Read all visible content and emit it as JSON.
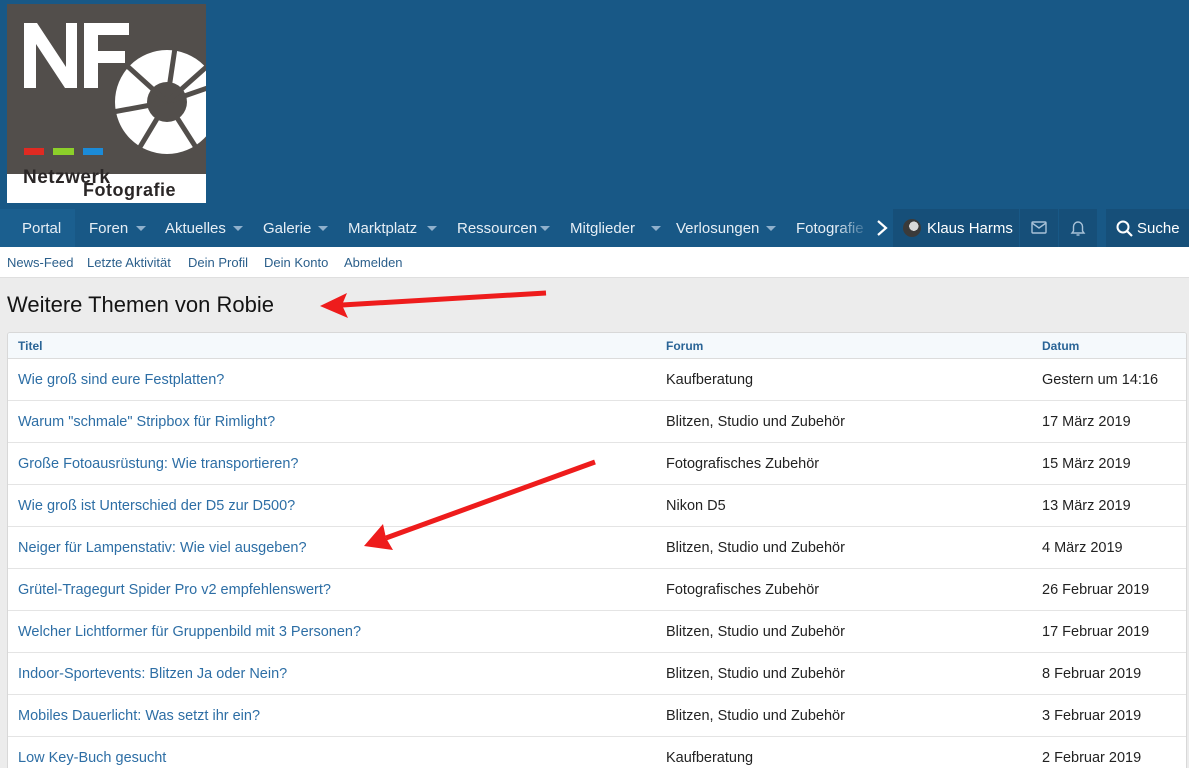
{
  "logo": {
    "letters": "NF",
    "word1": "Netzwerk",
    "word2": "Fotografie",
    "colors": [
      "#e02a22",
      "#8ccf2a",
      "#1b8bd8"
    ]
  },
  "nav": {
    "items": [
      {
        "label": "Portal",
        "dropdown": false
      },
      {
        "label": "Foren",
        "dropdown": true
      },
      {
        "label": "Aktuelles",
        "dropdown": true
      },
      {
        "label": "Galerie",
        "dropdown": true
      },
      {
        "label": "Marktplatz",
        "dropdown": true
      },
      {
        "label": "Ressourcen",
        "dropdown": true
      },
      {
        "label": "Mitglieder",
        "dropdown": true
      },
      {
        "label": "Verlosungen",
        "dropdown": true
      },
      {
        "label": "Fotografie",
        "dropdown": false
      }
    ],
    "user_name": "Klaus Harms",
    "search_label": "Suche"
  },
  "subnav": {
    "items": [
      "News-Feed",
      "Letzte Aktivität",
      "Dein Profil",
      "Dein Konto",
      "Abmelden"
    ]
  },
  "page": {
    "title": "Weitere Themen von Robie"
  },
  "table": {
    "headers": {
      "title": "Titel",
      "forum": "Forum",
      "date": "Datum"
    },
    "rows": [
      {
        "title": "Wie groß sind eure Festplatten?",
        "forum": "Kaufberatung",
        "date": "Gestern um 14:16"
      },
      {
        "title": "Warum \"schmale\" Stripbox für Rimlight?",
        "forum": "Blitzen, Studio und Zubehör",
        "date": "17 März 2019"
      },
      {
        "title": "Große Fotoausrüstung: Wie transportieren?",
        "forum": "Fotografisches Zubehör",
        "date": "15 März 2019"
      },
      {
        "title": "Wie groß ist Unterschied der D5 zur D500?",
        "forum": "Nikon D5",
        "date": "13 März 2019"
      },
      {
        "title": "Neiger für Lampenstativ: Wie viel ausgeben?",
        "forum": "Blitzen, Studio und Zubehör",
        "date": "4 März 2019"
      },
      {
        "title": "Grütel-Tragegurt Spider Pro v2 empfehlenswert?",
        "forum": "Fotografisches Zubehör",
        "date": "26 Februar 2019"
      },
      {
        "title": "Welcher Lichtformer für Gruppenbild mit 3 Personen?",
        "forum": "Blitzen, Studio und Zubehör",
        "date": "17 Februar 2019"
      },
      {
        "title": "Indoor-Sportevents: Blitzen Ja oder Nein?",
        "forum": "Blitzen, Studio und Zubehör",
        "date": "8 Februar 2019"
      },
      {
        "title": "Mobiles Dauerlicht: Was setzt ihr ein?",
        "forum": "Blitzen, Studio und Zubehör",
        "date": "3 Februar 2019"
      },
      {
        "title": "Low Key-Buch gesucht",
        "forum": "Kaufberatung",
        "date": "2 Februar 2019"
      }
    ]
  },
  "annotation_color": "#ee1c1c",
  "icons": {
    "more": "chevron-right-icon",
    "mail": "envelope-icon",
    "alerts": "bell-icon",
    "search": "search-icon"
  }
}
